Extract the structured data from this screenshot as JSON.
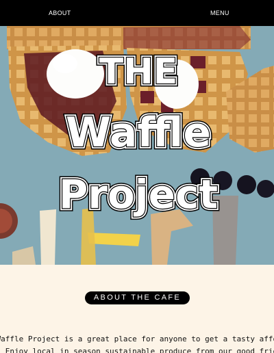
{
  "nav": {
    "about_label": "ABOUT",
    "menu_label": "MENU"
  },
  "hero": {
    "title_line1": "THE",
    "title_line2": "Waffle",
    "title_line3": "Project"
  },
  "about": {
    "heading": "ABOUT THE CAFE",
    "line1": "The Waffle Project is a great place for anyone to get a tasty affordable",
    "line2": "meal. Enjoy local in season sustainable produce from our good friends at"
  },
  "colors": {
    "topbar": "#000000",
    "background": "#fdf4e7",
    "plate": "#7fa6b2",
    "waffle": "#d9a25a",
    "jam": "#5a1822",
    "cream": "#ffffff"
  }
}
